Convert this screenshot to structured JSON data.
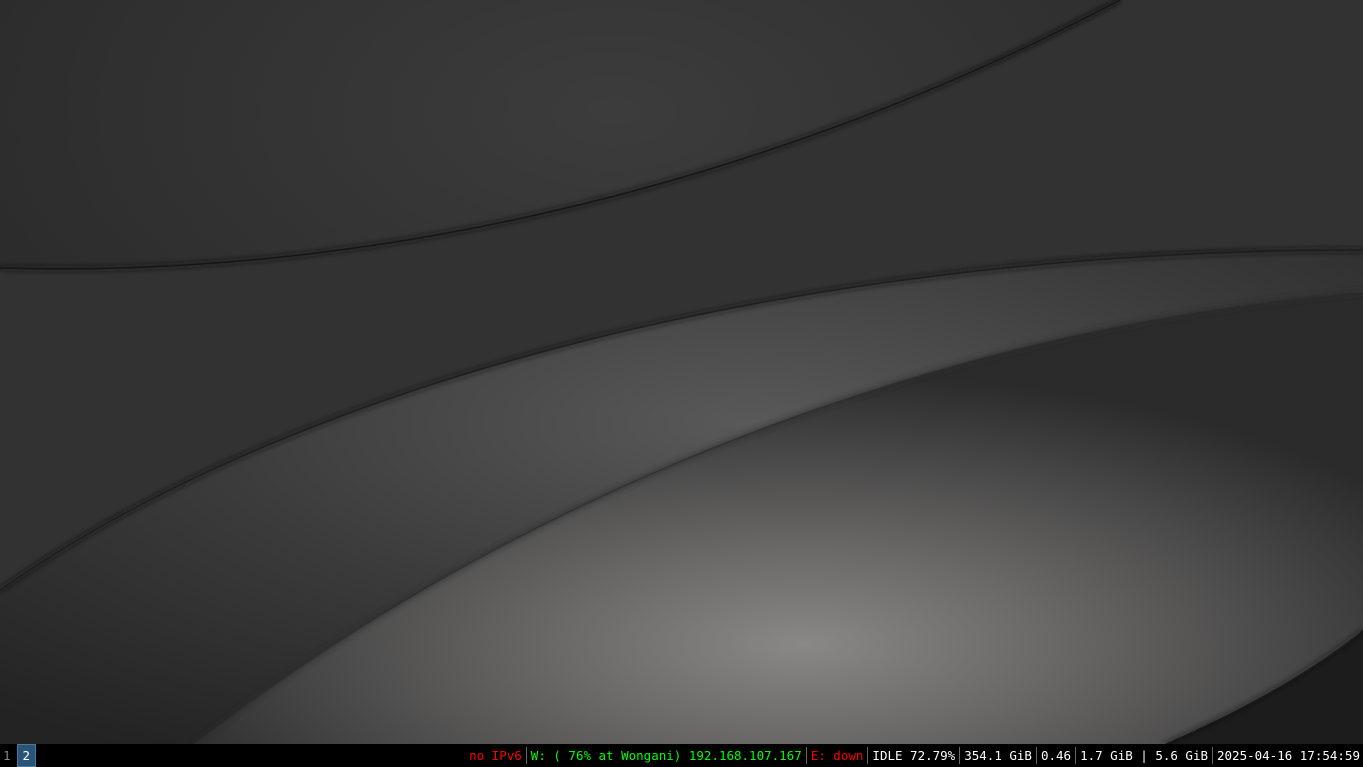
{
  "workspaces": [
    {
      "label": "1",
      "focused": false
    },
    {
      "label": "2",
      "focused": true
    }
  ],
  "status": {
    "ipv6": "no IPv6",
    "wireless": "W: ( 76% at Wongani) 192.168.107.167",
    "ethernet": "E: down",
    "cpu": "IDLE 72.79%",
    "disk": "354.1 GiB",
    "load": "0.46",
    "memory": "1.7 GiB | 5.6 GiB",
    "datetime": "2025-04-16 17:54:59"
  },
  "colors": {
    "bar_background": "#000000",
    "status_bad": "#ff0000",
    "status_good": "#00ff00",
    "status_normal": "#ffffff",
    "workspace_focused_bg": "#285577",
    "workspace_focused_border": "#4c7899",
    "workspace_inactive_text": "#888888"
  }
}
